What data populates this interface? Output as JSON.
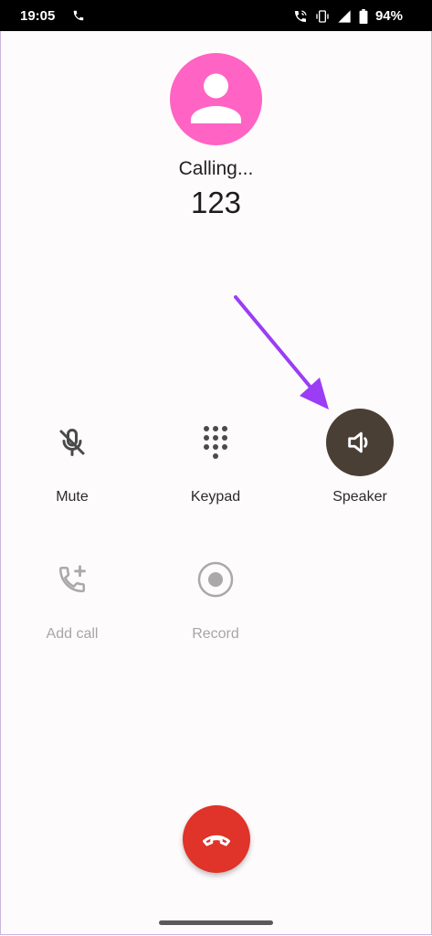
{
  "status_bar": {
    "time": "19:05",
    "battery": "94%"
  },
  "call": {
    "status": "Calling...",
    "number": "123"
  },
  "controls": {
    "mute": "Mute",
    "keypad": "Keypad",
    "speaker": "Speaker",
    "add_call": "Add call",
    "record": "Record"
  },
  "colors": {
    "avatar": "#ff63c3",
    "speaker_active": "#4a3f35",
    "end_call": "#e03329",
    "arrow": "#9b3df5"
  },
  "icons": {
    "mute": "mic-off-icon",
    "keypad": "dialpad-icon",
    "speaker": "speaker-icon",
    "add_call": "add-call-icon",
    "record": "record-icon",
    "end_call": "end-call-icon"
  }
}
